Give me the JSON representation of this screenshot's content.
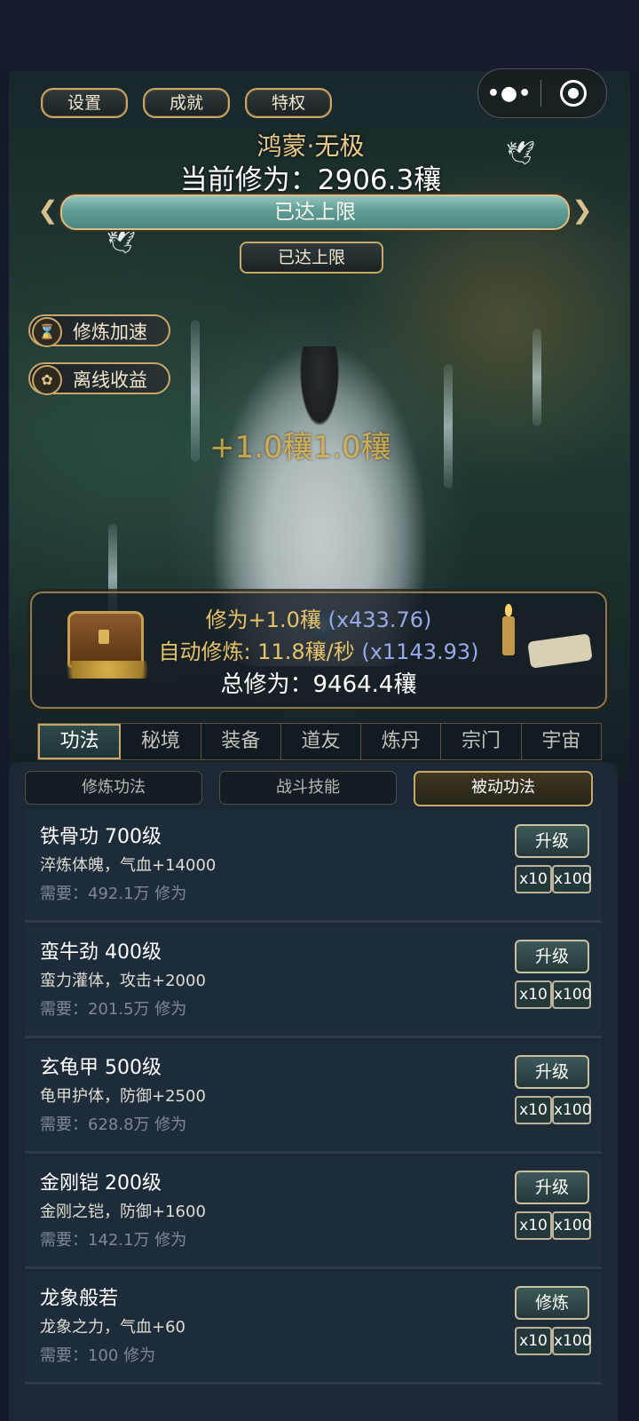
{
  "top_buttons": {
    "settings": "设置",
    "achievements": "成就",
    "privileges": "特权"
  },
  "capsule": {
    "more": "•●•"
  },
  "header": {
    "realm": "鸿蒙·无极",
    "current_cultivation": "当前修为：2906.3穰",
    "progress_label": "已达上限",
    "progress_fraction": 1.0,
    "limit_button": "已达上限"
  },
  "side_buttons": {
    "speedup": {
      "label": "修炼加速",
      "icon": "hourglass-icon"
    },
    "offline": {
      "label": "离线收益",
      "icon": "lotus-icon"
    }
  },
  "floating_gain": "+1.0穰1.0穰",
  "info": {
    "gain_prefix": "修为+1.0穰",
    "gain_mult": "(x433.76)",
    "auto_prefix": "自动修炼: 11.8穰/秒",
    "auto_mult": "(x1143.93)",
    "total": "总修为：9464.4穰"
  },
  "main_tabs": [
    "功法",
    "秘境",
    "装备",
    "道友",
    "炼丹",
    "宗门",
    "宇宙"
  ],
  "sub_tabs": [
    "修炼功法",
    "战斗技能",
    "被动功法"
  ],
  "skills": [
    {
      "name": "铁骨功 700级",
      "desc": "淬炼体魄，气血+14000",
      "need": "需要：492.1万 修为",
      "action": "升级",
      "x10": "x10",
      "x100": "x100"
    },
    {
      "name": "蛮牛劲 400级",
      "desc": "蛮力灌体，攻击+2000",
      "need": "需要：201.5万 修为",
      "action": "升级",
      "x10": "x10",
      "x100": "x100"
    },
    {
      "name": "玄龟甲 500级",
      "desc": "龟甲护体，防御+2500",
      "need": "需要：628.8万 修为",
      "action": "升级",
      "x10": "x10",
      "x100": "x100"
    },
    {
      "name": "金刚铠 200级",
      "desc": "金刚之铠，防御+1600",
      "need": "需要：142.1万 修为",
      "action": "升级",
      "x10": "x10",
      "x100": "x100"
    },
    {
      "name": "龙象般若",
      "desc": "龙象之力，气血+60",
      "need": "需要：100 修为",
      "action": "修炼",
      "x10": "x10",
      "x100": "x100"
    }
  ],
  "colors": {
    "gold": "#e6c26c",
    "accent_teal": "#4a8880",
    "multiplier_blue": "#98a8e8"
  }
}
